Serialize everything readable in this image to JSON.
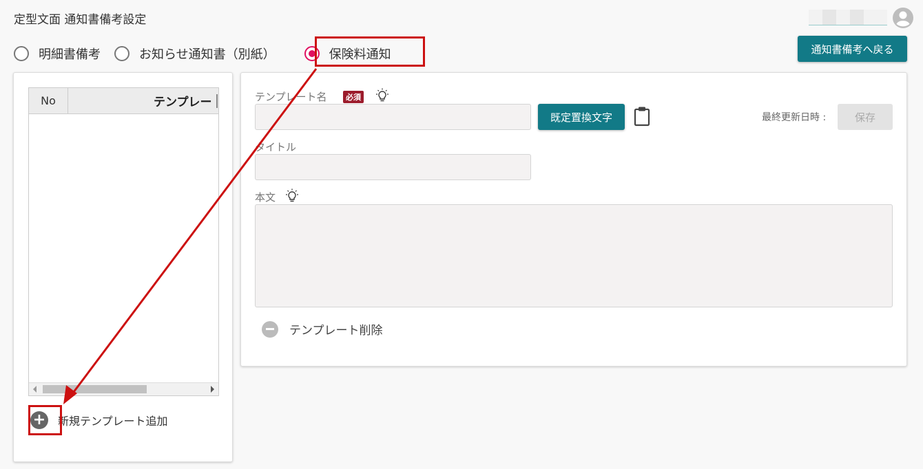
{
  "header": {
    "title": "定型文面 通知書備考設定"
  },
  "radios": [
    {
      "label": "明細書備考",
      "selected": false
    },
    {
      "label": "お知らせ通知書（別紙）",
      "selected": false
    },
    {
      "label": "保険料通知",
      "selected": true
    }
  ],
  "back_button": "通知書備考へ戻る",
  "template_table": {
    "columns": [
      "No",
      "テンプレー"
    ]
  },
  "add_template": "新規テンプレート追加",
  "form": {
    "template_name_label": "テンプレート名",
    "required_badge": "必須",
    "replace_button": "既定置換文字",
    "last_updated_label": "最終更新日時 :",
    "save_button": "保存",
    "title_label": "タイトル",
    "body_label": "本文",
    "delete_label": "テンプレート削除"
  },
  "colors": {
    "accent_teal": "#127a87",
    "radio_selected": "#e01060",
    "annotation_red": "#cc1111",
    "required_badge": "#9c1c2c"
  },
  "icons": [
    "user-avatar-icon",
    "lightbulb-icon",
    "clipboard-icon",
    "plus-circle-icon",
    "minus-circle-icon"
  ]
}
